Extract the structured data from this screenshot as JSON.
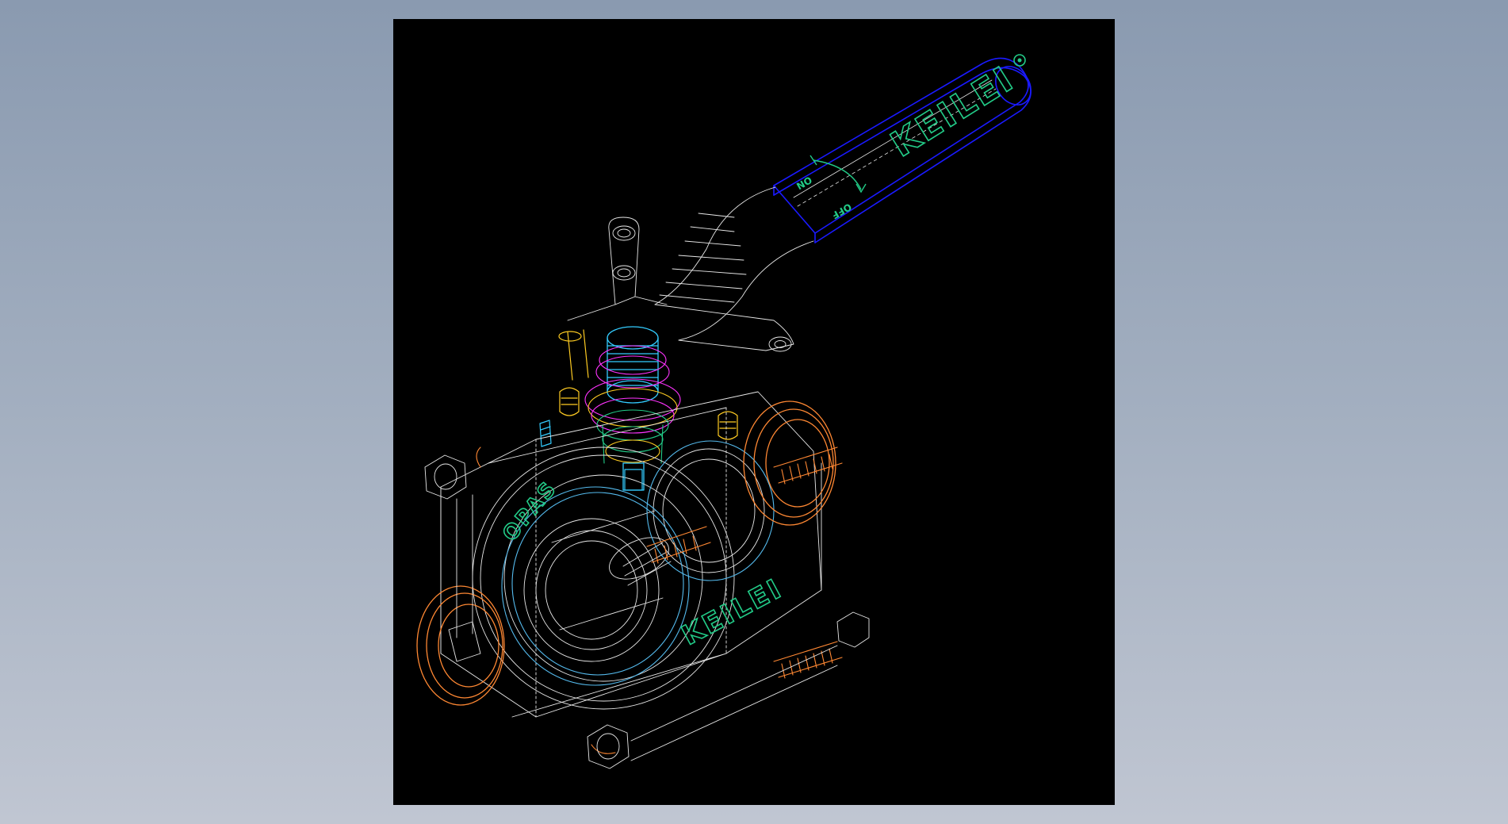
{
  "drawing": {
    "handle_brand": "KEILEI",
    "body_brand": "KEILEI",
    "body_side_text": "OPAS",
    "handle_label_on": "ON",
    "handle_label_off": "OFF"
  },
  "colors": {
    "background_top": "#8a9ab0",
    "background_bottom": "#c0c6d2",
    "panel": "#000000",
    "wire_white": "#e8e8e8",
    "handle_blue": "#1a1aff",
    "brand_green": "#22cc88",
    "stem_cyan": "#33ccff",
    "ring_magenta": "#ff33ff",
    "bolt_orange": "#ff8833",
    "nut_yellow": "#ffcc22",
    "seat_lightblue": "#55bbee"
  },
  "icons": {
    "arrow": "curved-rotation-arrow",
    "pivot": "handle-pivot-dot"
  }
}
